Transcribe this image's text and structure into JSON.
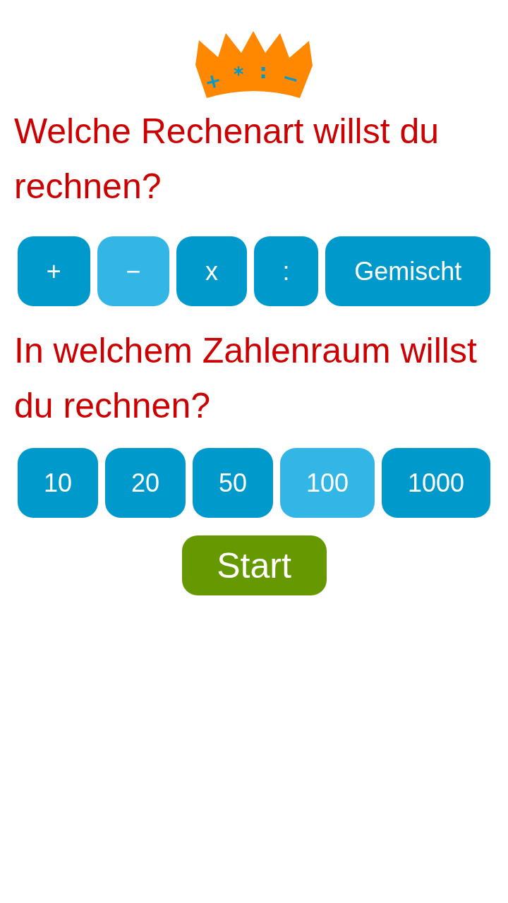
{
  "logo": {
    "symbols": [
      "+",
      "*",
      ":",
      "−"
    ]
  },
  "operation_prompt": "Welche Rechenart willst du rechnen?",
  "operations": [
    {
      "label": "+",
      "selected": false
    },
    {
      "label": "−",
      "selected": true
    },
    {
      "label": "x",
      "selected": false
    },
    {
      "label": ":",
      "selected": false
    },
    {
      "label": "Gemischt",
      "selected": false
    }
  ],
  "range_prompt": "In welchem Zahlenraum willst du rechnen?",
  "ranges": [
    {
      "label": "10",
      "selected": false
    },
    {
      "label": "20",
      "selected": false
    },
    {
      "label": "50",
      "selected": false
    },
    {
      "label": "100",
      "selected": true
    },
    {
      "label": "1000",
      "selected": false
    }
  ],
  "start_button": {
    "label": "Start"
  }
}
